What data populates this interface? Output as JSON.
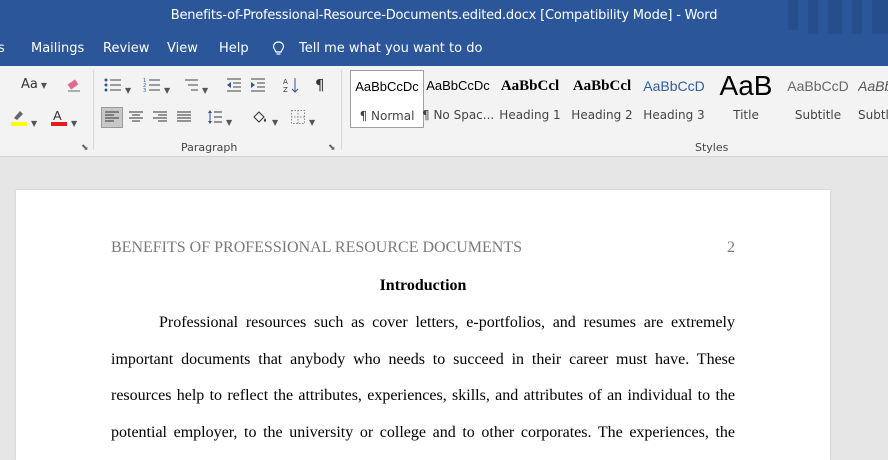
{
  "window": {
    "title": "Benefits-of-Professional-Resource-Documents.edited.docx [Compatibility Mode]  -  Word"
  },
  "menu": {
    "items": [
      "s",
      "Mailings",
      "Review",
      "View",
      "Help"
    ],
    "tell_me": "Tell me what you want to do"
  },
  "ribbon": {
    "font_size_label": "Aa",
    "paragraph_group": "Paragraph",
    "styles_group": "Styles",
    "styles": [
      {
        "sample": "AaBbCcDc",
        "name": "¶ Normal"
      },
      {
        "sample": "AaBbCcDc",
        "name": "¶ No Spac..."
      },
      {
        "sample": "AaBbCcl",
        "name": "Heading 1"
      },
      {
        "sample": "AaBbCcl",
        "name": "Heading 2"
      },
      {
        "sample": "AaBbCcD",
        "name": "Heading 3"
      },
      {
        "sample": "AaB",
        "name": "Title"
      },
      {
        "sample": "AaBbCcD",
        "name": "Subtitle"
      },
      {
        "sample": "AaBbl",
        "name": "Subtle"
      }
    ]
  },
  "document": {
    "running_header": "BENEFITS OF PROFESSIONAL RESOURCE DOCUMENTS",
    "page_number": "2",
    "heading": "Introduction",
    "lines": [
      "Professional resources such as cover letters, e-portfolios, and resumes are extremely",
      "important documents that anybody who needs to succeed in their career must have. These",
      "resources help to reflect the attributes, experiences, skills, and attributes of an individual to the",
      "potential employer, to the university or college and to other corporates.  The experiences, the"
    ]
  }
}
